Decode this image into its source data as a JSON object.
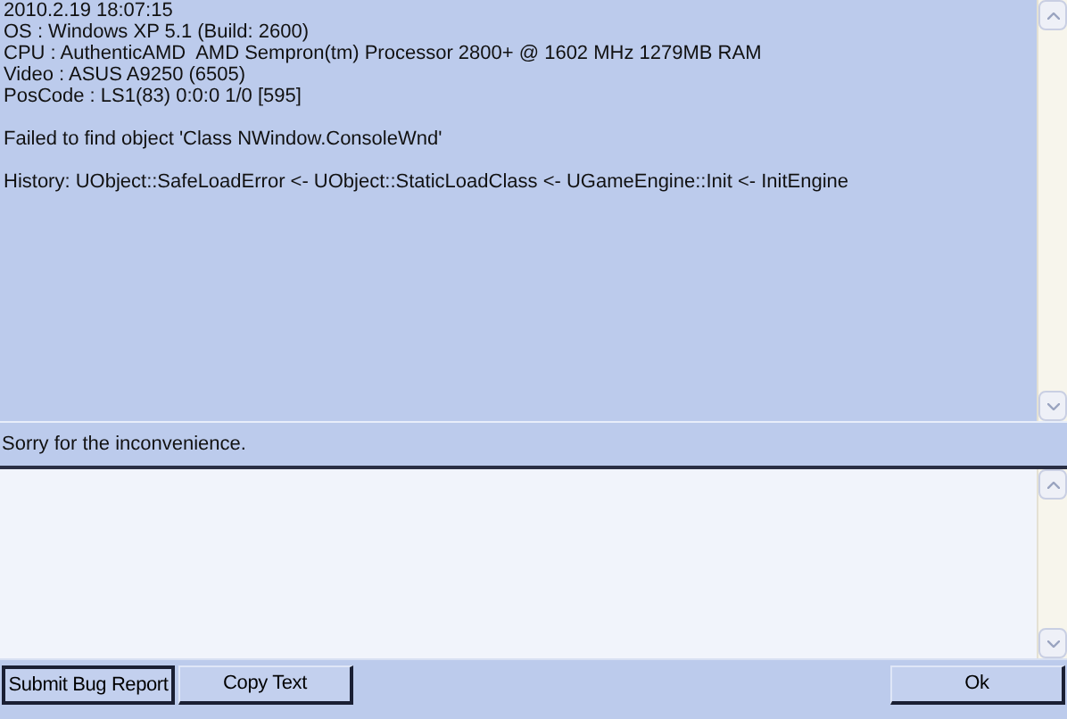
{
  "log": {
    "paragraphs": [
      [
        "2010.2.19 18:07:15",
        "OS : Windows XP 5.1 (Build: 2600)",
        "CPU : AuthenticAMD  AMD Sempron(tm) Processor 2800+ @ 1602 MHz 1279MB RAM",
        "Video : ASUS A9250 (6505)",
        "PosCode : LS1(83) 0:0:0 1/0 [595]"
      ],
      [
        "Failed to find object 'Class NWindow.ConsoleWnd'"
      ],
      [
        "History: UObject::SafeLoadError <- UObject::StaticLoadClass <- UGameEngine::Init <- InitEngine"
      ]
    ]
  },
  "message": "Sorry for the inconvenience.",
  "buttons": [
    {
      "label": "Submit Bug Report",
      "focused": true
    },
    {
      "label": "Copy Text",
      "focused": false
    },
    {
      "label": "Ok",
      "focused": false
    }
  ]
}
